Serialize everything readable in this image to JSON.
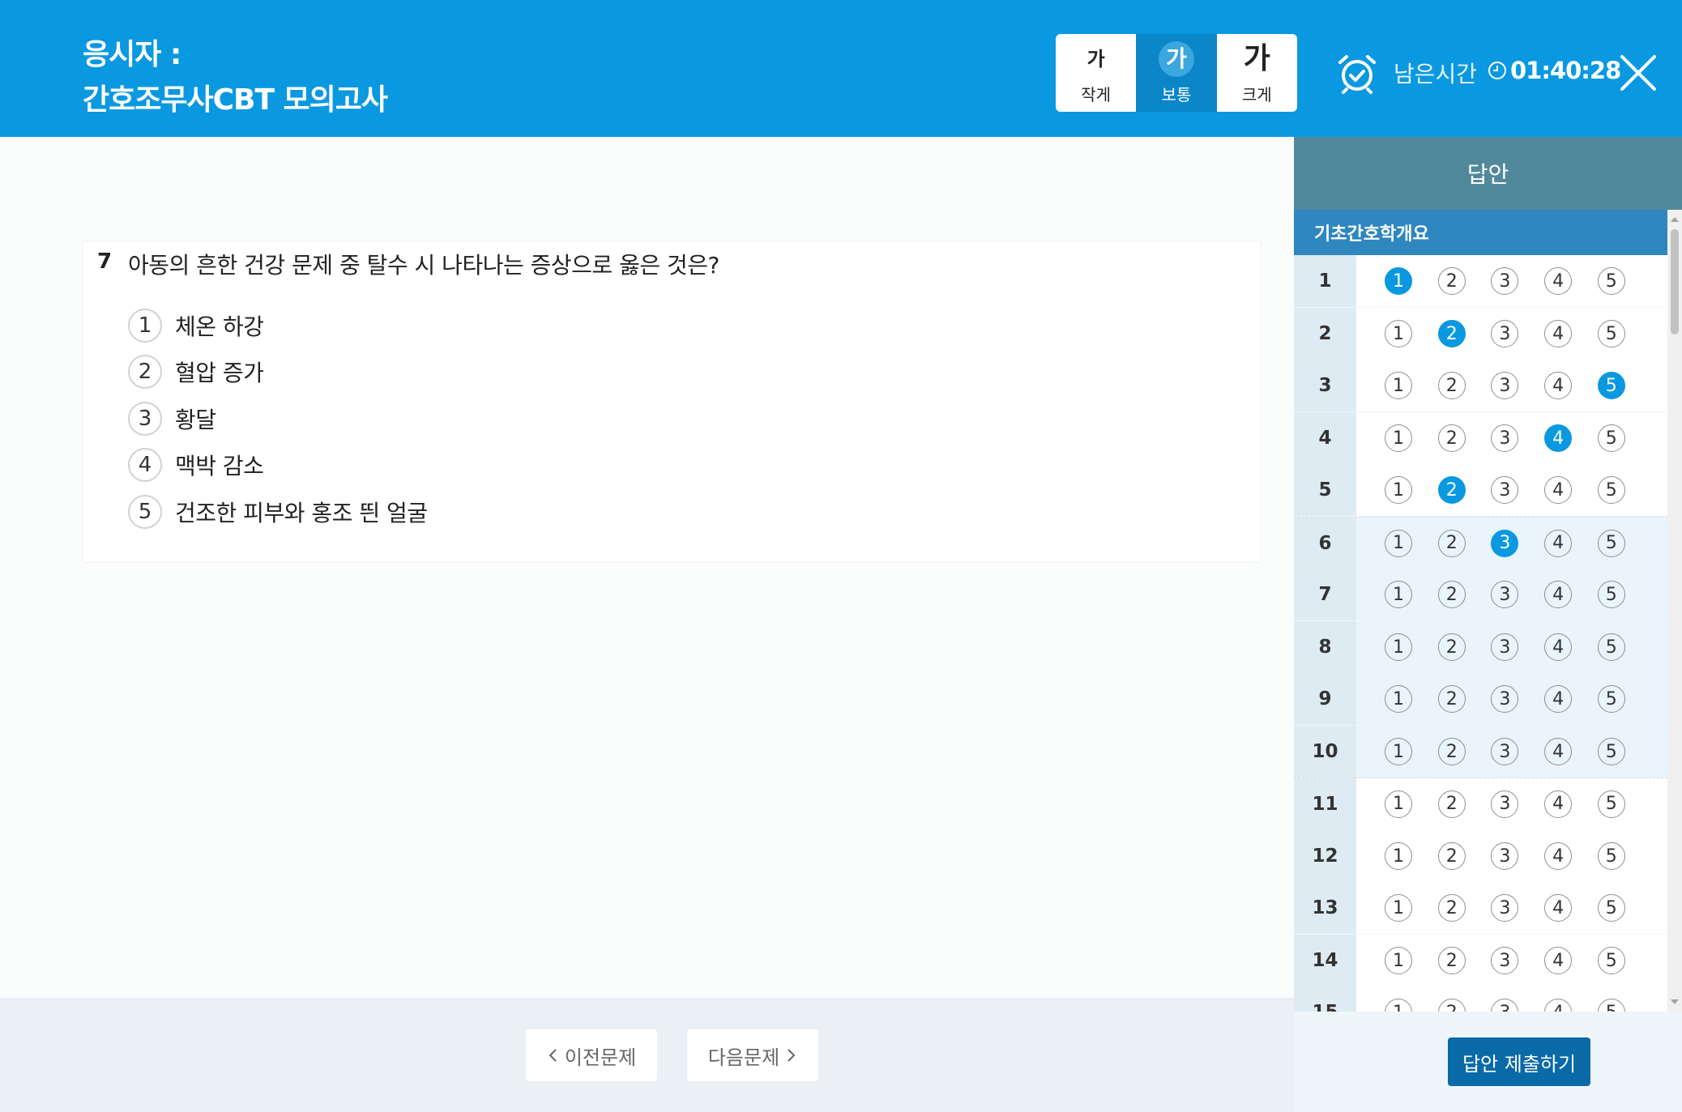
{
  "header": {
    "examinee_label": "응시자 :",
    "exam_title": "간호조무사CBT 모의고사",
    "font_sizes": [
      {
        "glyph": "가",
        "label": "작게"
      },
      {
        "glyph": "가",
        "label": "보통"
      },
      {
        "glyph": "가",
        "label": "크게"
      }
    ],
    "active_font_size": "보통",
    "remaining_label": "남은시간",
    "remaining_time": "01:40:28"
  },
  "question": {
    "number": "7",
    "text": "아동의 흔한 건강 문제 중 탈수 시 나타나는 증상으로 옳은 것은?",
    "choices": [
      {
        "num": "1",
        "text": "체온 하강"
      },
      {
        "num": "2",
        "text": "혈압 증가"
      },
      {
        "num": "3",
        "text": "황달"
      },
      {
        "num": "4",
        "text": "맥박 감소"
      },
      {
        "num": "5",
        "text": "건조한 피부와 홍조 띈 얼굴"
      }
    ]
  },
  "nav": {
    "prev_label": "이전문제",
    "next_label": "다음문제"
  },
  "answer_sheet": {
    "title": "답안",
    "section": "기초간호학개요",
    "options": [
      "1",
      "2",
      "3",
      "4",
      "5"
    ],
    "rows": [
      {
        "q": "1",
        "selected": "1"
      },
      {
        "q": "2",
        "selected": "2"
      },
      {
        "q": "3",
        "selected": "5"
      },
      {
        "q": "4",
        "selected": "4"
      },
      {
        "q": "5",
        "selected": "2"
      },
      {
        "q": "6",
        "selected": "3"
      },
      {
        "q": "7",
        "selected": ""
      },
      {
        "q": "8",
        "selected": ""
      },
      {
        "q": "9",
        "selected": ""
      },
      {
        "q": "10",
        "selected": ""
      },
      {
        "q": "11",
        "selected": ""
      },
      {
        "q": "12",
        "selected": ""
      },
      {
        "q": "13",
        "selected": ""
      },
      {
        "q": "14",
        "selected": ""
      },
      {
        "q": "15",
        "selected": ""
      }
    ],
    "submit_label": "답안 제출하기"
  },
  "colors": {
    "header_bg": "#0a99e0",
    "selected_bubble": "#0a99e0",
    "side_head_bg": "#52889b",
    "section_bar_bg": "#2e87bf",
    "submit_bg": "#0a6aa8"
  }
}
